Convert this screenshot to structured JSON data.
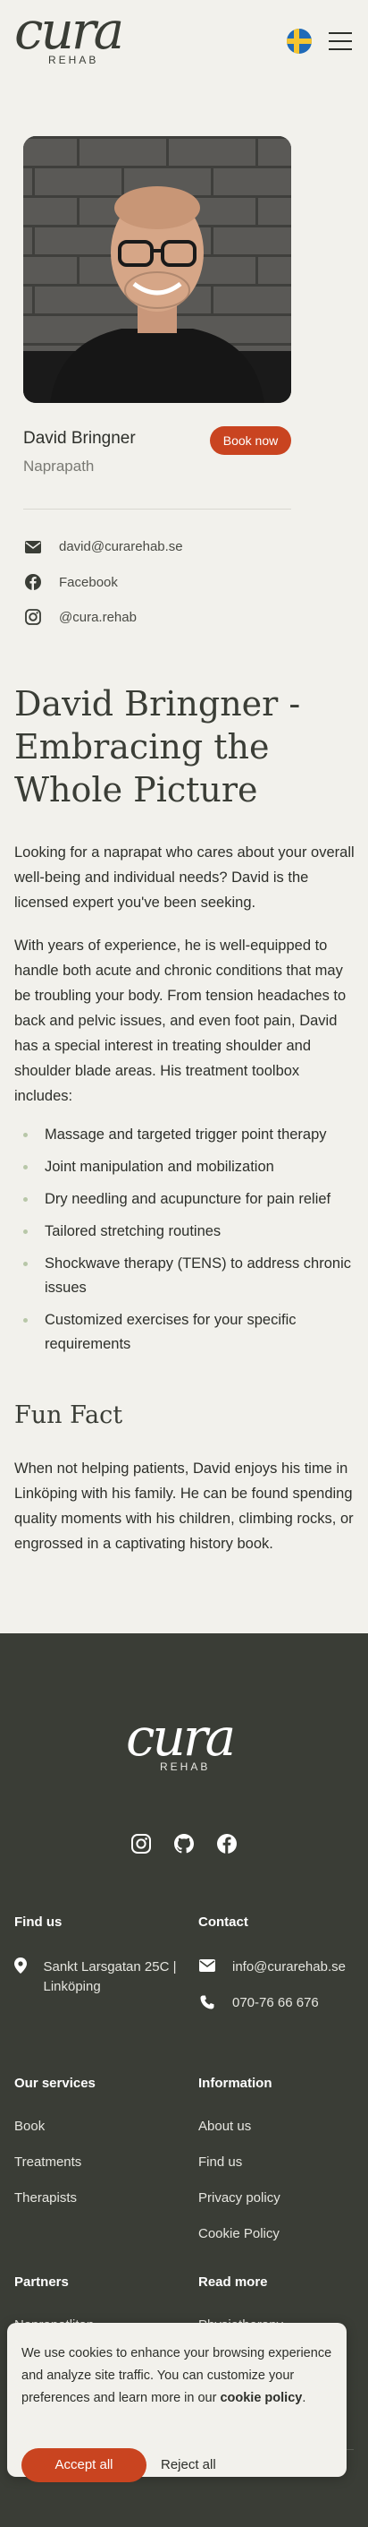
{
  "brand": {
    "logo": "cura",
    "sub": "REHAB"
  },
  "profile": {
    "name": "David Bringner",
    "role": "Naprapath",
    "book_label": "Book now",
    "email": "david@curarehab.se",
    "facebook": "Facebook",
    "instagram": "@cura.rehab"
  },
  "article": {
    "title": "David Bringner - Embracing the Whole Picture",
    "intro": "Looking for a naprapat who cares about your overall well-being and individual needs? David is the licensed expert you've been seeking.",
    "body": "With years of experience, he is well-equipped to handle both acute and chronic conditions that may be troubling your body. From tension headaches to back and pelvic issues, and even foot pain, David has a special interest in treating shoulder and shoulder blade areas. His treatment toolbox includes:",
    "list": [
      "Massage and targeted trigger point therapy",
      "Joint manipulation and mobilization",
      "Dry needling and acupuncture for pain relief",
      "Tailored stretching routines",
      "Shockwave therapy (TENS) to address chronic issues",
      "Customized exercises for your specific requirements"
    ],
    "fun_fact_title": "Fun Fact",
    "fun_fact": "When not helping patients, David enjoys his time in Linköping with his family. He can be found spending quality moments with his children, climbing rocks, or engrossed in a captivating history book."
  },
  "footer": {
    "find_us": "Find us",
    "address": "Sankt Larsgatan 25C | Linköping",
    "contact": "Contact",
    "email": "info@curarehab.se",
    "phone": "070-76 66 676",
    "services_title": "Our services",
    "services": [
      "Book",
      "Treatments",
      "Therapists"
    ],
    "info_title": "Information",
    "info": [
      "About us",
      "Find us",
      "Privacy policy",
      "Cookie Policy"
    ],
    "partners_title": "Partners",
    "partners_first": "Naprapatlitan",
    "read_more_title": "Read more",
    "read_more_first": "Physiotherapy"
  },
  "cookie": {
    "text": "We use cookies to enhance your browsing experience and analyze site traffic. You can customize your preferences and learn more in our",
    "link": "cookie policy",
    "accept": "Accept all",
    "reject": "Reject all"
  },
  "colors": {
    "accent": "#c94420",
    "footer": "#3a3d36",
    "background": "#f2f1ec"
  }
}
